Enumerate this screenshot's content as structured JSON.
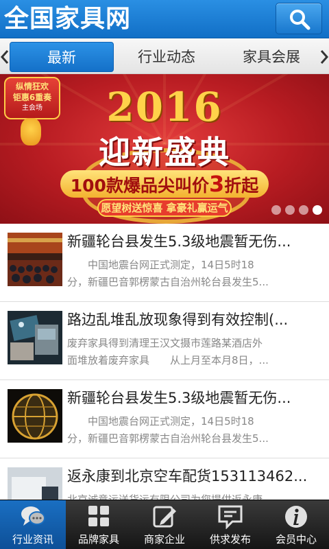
{
  "header": {
    "title": "全国家具网",
    "search_icon": "search-icon",
    "bg_color": "#1a7dd5"
  },
  "tabs": {
    "items": [
      {
        "label": "最新",
        "active": true
      },
      {
        "label": "行业动态",
        "active": false
      },
      {
        "label": "家具会展",
        "active": false
      }
    ],
    "active_color": "#1a7dd5"
  },
  "banner": {
    "badge_line1": "纵情狂欢",
    "badge_line2": "钜惠6重奏",
    "badge_line3": "主会场",
    "year": "2016",
    "headline": "迎新盛典",
    "subline_pre": "100款爆品尖叫价",
    "subline_num": "3",
    "subline_post": "折起",
    "slogan": "愿望树送惊喜 拿豪礼赢运气",
    "slide_count": 4,
    "active_slide": 4
  },
  "news": [
    {
      "title": "新疆轮台县发生5.3级地震暂无伤...",
      "desc_line1": "　　中国地震台网正式测定，14日5时18",
      "desc_line2": "分，新疆巴音郭楞蒙古自治州轮台县发生5...",
      "thumb": "meeting-photo"
    },
    {
      "title": "路边乱堆乱放现象得到有效控制(...",
      "desc_line1": "废弃家具得到清理王汉文摄市莲路某酒店外",
      "desc_line2": "面堆放着废弃家具　　从上月至本月8日，...",
      "thumb": "night-street-photo"
    },
    {
      "title": "新疆轮台县发生5.3级地震暂无伤...",
      "desc_line1": "　　中国地震台网正式测定，14日5时18",
      "desc_line2": "分，新疆巴音郭楞蒙古自治州轮台县发生5...",
      "thumb": "globe-photo"
    },
    {
      "title": "返永康到北京空车配货153113462...",
      "desc_line1": "北京诚意运送货运有限公司为您提供返永康",
      "desc_line2": "",
      "thumb": "truck-photo"
    }
  ],
  "bottom_nav": [
    {
      "label": "行业资讯",
      "icon": "chat-bubbles-icon",
      "active": true
    },
    {
      "label": "品牌家具",
      "icon": "grid-icon",
      "active": false
    },
    {
      "label": "商家企业",
      "icon": "edit-icon",
      "active": false
    },
    {
      "label": "供求发布",
      "icon": "message-icon",
      "active": false
    },
    {
      "label": "会员中心",
      "icon": "info-icon",
      "active": false
    }
  ]
}
